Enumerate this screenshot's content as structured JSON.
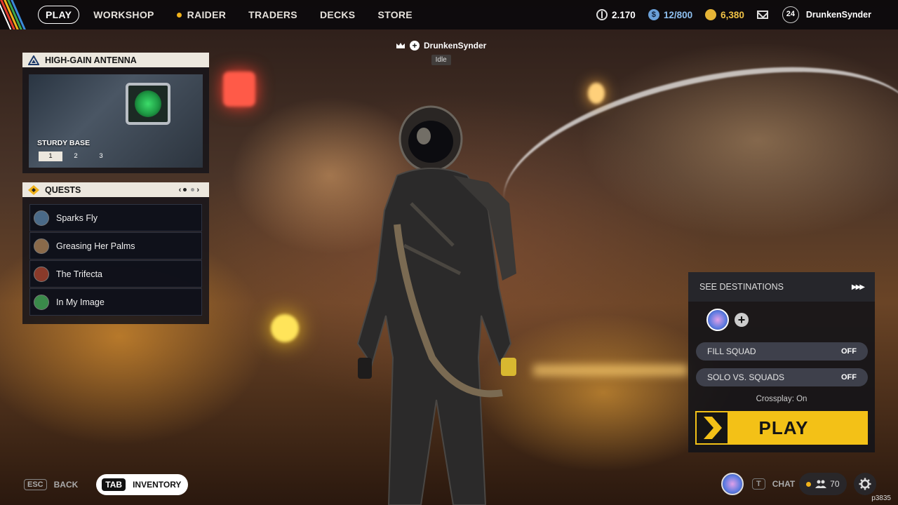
{
  "nav": {
    "items": [
      "PLAY",
      "WORKSHOP",
      "RAIDER",
      "TRADERS",
      "DECKS",
      "STORE"
    ],
    "active": "PLAY"
  },
  "currencies": {
    "coins": "2.170",
    "storage": "12/800",
    "gold": "6,380"
  },
  "user": {
    "level": "24",
    "name": "DrunkenSynder"
  },
  "player_tag": {
    "name": "DrunkenSynder",
    "status": "Idle"
  },
  "antenna_panel": {
    "title": "HIGH-GAIN ANTENNA",
    "subtitle": "STURDY BASE",
    "tiers": [
      "1",
      "2",
      "3"
    ],
    "active_tier": "1"
  },
  "quests_panel": {
    "title": "QUESTS",
    "items": [
      {
        "label": "Sparks Fly",
        "icon": "quest-sparks-icon",
        "color": "#4a6a88"
      },
      {
        "label": "Greasing Her Palms",
        "icon": "quest-portrait-icon",
        "color": "#8a6a4a"
      },
      {
        "label": "The Trifecta",
        "icon": "quest-trifecta-icon",
        "color": "#8a3a2a"
      },
      {
        "label": "In My Image",
        "icon": "quest-image-icon",
        "color": "#3a8a4a"
      }
    ]
  },
  "bottom_left": {
    "esc_key": "ESC",
    "back_label": "BACK",
    "tab_key": "TAB",
    "inventory_label": "INVENTORY"
  },
  "right_panel": {
    "see_destinations": "SEE DESTINATIONS",
    "fill_squad": {
      "label": "FILL SQUAD",
      "value": "OFF"
    },
    "solo_vs_squads": {
      "label": "SOLO VS. SQUADS",
      "value": "OFF"
    },
    "crossplay": "Crossplay: On",
    "play_label": "PLAY"
  },
  "bottom_right": {
    "chat_key": "T",
    "chat_label": "CHAT",
    "friends_count": "70"
  },
  "build": "p3835",
  "colors": {
    "accent_yellow": "#f3c117",
    "panel_header": "#ece7de",
    "raider_dot": "#f0b21a"
  }
}
